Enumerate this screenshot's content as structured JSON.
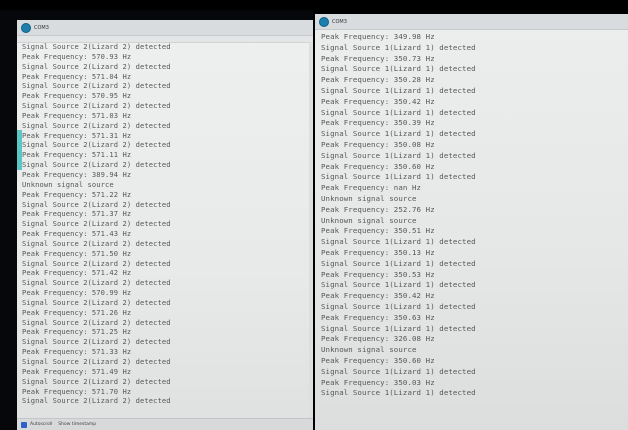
{
  "left_window": {
    "title": "COM3",
    "status": {
      "autoscroll": "Autoscroll",
      "timestamp": "Show timestamp"
    },
    "lines": [
      "Signal Source 2(Lizard 2) detected",
      "Peak Frequency: 570.93 Hz",
      "Signal Source 2(Lizard 2) detected",
      "Peak Frequency: 571.04 Hz",
      "Signal Source 2(Lizard 2) detected",
      "Peak Frequency: 570.95 Hz",
      "Signal Source 2(Lizard 2) detected",
      "Peak Frequency: 571.03 Hz",
      "Signal Source 2(Lizard 2) detected",
      "Peak Frequency: 571.31 Hz",
      "Signal Source 2(Lizard 2) detected",
      "Peak Frequency: 571.11 Hz",
      "Signal Source 2(Lizard 2) detected",
      "Peak Frequency: 389.94 Hz",
      "Unknown signal source",
      "Peak Frequency: 571.22 Hz",
      "Signal Source 2(Lizard 2) detected",
      "Peak Frequency: 571.37 Hz",
      "Signal Source 2(Lizard 2) detected",
      "Peak Frequency: 571.43 Hz",
      "Signal Source 2(Lizard 2) detected",
      "Peak Frequency: 571.50 Hz",
      "Signal Source 2(Lizard 2) detected",
      "Peak Frequency: 571.42 Hz",
      "Signal Source 2(Lizard 2) detected",
      "Peak Frequency: 570.99 Hz",
      "Signal Source 2(Lizard 2) detected",
      "Peak Frequency: 571.26 Hz",
      "Signal Source 2(Lizard 2) detected",
      "Peak Frequency: 571.25 Hz",
      "Signal Source 2(Lizard 2) detected",
      "Peak Frequency: 571.33 Hz",
      "Signal Source 2(Lizard 2) detected",
      "Peak Frequency: 571.49 Hz",
      "Signal Source 2(Lizard 2) detected",
      "Peak Frequency: 571.70 Hz",
      "Signal Source 2(Lizard 2) detected"
    ]
  },
  "right_window": {
    "title": "COM3",
    "lines": [
      "Peak Frequency: 349.98 Hz",
      "Signal Source 1(Lizard 1) detected",
      "Peak Frequency: 350.73 Hz",
      "Signal Source 1(Lizard 1) detected",
      "Peak Frequency: 350.28 Hz",
      "Signal Source 1(Lizard 1) detected",
      "Peak Frequency: 350.42 Hz",
      "Signal Source 1(Lizard 1) detected",
      "Peak Frequency: 350.39 Hz",
      "Signal Source 1(Lizard 1) detected",
      "Peak Frequency: 350.08 Hz",
      "Signal Source 1(Lizard 1) detected",
      "Peak Frequency: 350.60 Hz",
      "Signal Source 1(Lizard 1) detected",
      "Peak Frequency: nan Hz",
      "Unknown signal source",
      "Peak Frequency: 252.76 Hz",
      "Unknown signal source",
      "Peak Frequency: 350.51 Hz",
      "Signal Source 1(Lizard 1) detected",
      "Peak Frequency: 350.13 Hz",
      "Signal Source 1(Lizard 1) detected",
      "Peak Frequency: 350.53 Hz",
      "Signal Source 1(Lizard 1) detected",
      "Peak Frequency: 350.42 Hz",
      "Signal Source 1(Lizard 1) detected",
      "Peak Frequency: 350.63 Hz",
      "Signal Source 1(Lizard 1) detected",
      "Peak Frequency: 326.08 Hz",
      "Unknown signal source",
      "Peak Frequency: 350.60 Hz",
      "Signal Source 1(Lizard 1) detected",
      "Peak Frequency: 350.03 Hz",
      "Signal Source 1(Lizard 1) detected"
    ]
  }
}
